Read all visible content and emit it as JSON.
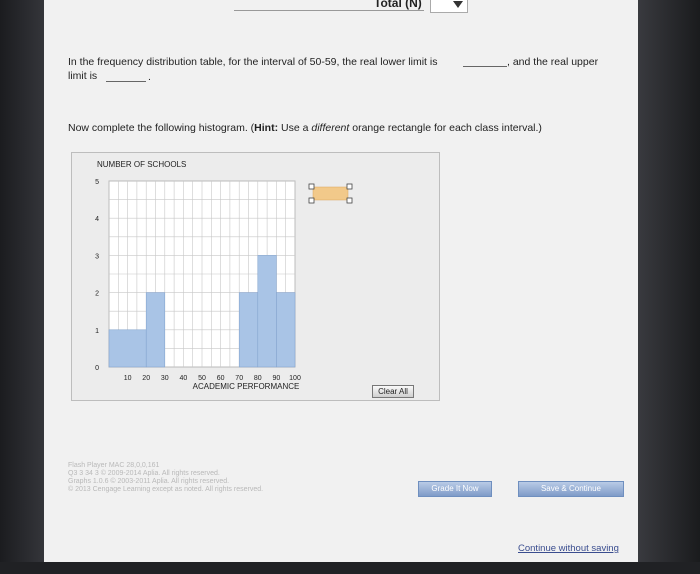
{
  "header": {
    "total_label": "Total (N)"
  },
  "question": {
    "part1": "In the frequency distribution table, for the interval of 50-59, the real lower limit is",
    "part2": ", and the real upper",
    "part3": "limit is",
    "part4": "."
  },
  "instruction": {
    "lead": "Now complete the following histogram. (",
    "hint_label": "Hint:",
    "hint_pre": " Use a ",
    "hint_em": "different",
    "hint_post": " orange rectangle for each class interval.)"
  },
  "chart_data": {
    "type": "bar",
    "ylabel": "NUMBER OF SCHOOLS",
    "xlabel": "ACADEMIC PERFORMANCE",
    "yticks": [
      0,
      1,
      2,
      3,
      4,
      5
    ],
    "xticks": [
      10,
      20,
      30,
      40,
      50,
      60,
      70,
      80,
      90,
      100
    ],
    "xlim": [
      0,
      100
    ],
    "ylim": [
      0,
      5
    ],
    "bars": [
      {
        "x0": 0,
        "x1": 20,
        "value": 1
      },
      {
        "x0": 20,
        "x1": 30,
        "value": 2
      },
      {
        "x0": 70,
        "x1": 80,
        "value": 2
      },
      {
        "x0": 80,
        "x1": 90,
        "value": 3
      },
      {
        "x0": 90,
        "x1": 100,
        "value": 2
      }
    ],
    "bar_color": "#a9c4e6",
    "template_color": "#f2c98a"
  },
  "chart_panel": {
    "clear_label": "Clear All"
  },
  "footer": {
    "lines": [
      "Flash Player MAC 28,0,0,161",
      "Q3 3 34 3 © 2009-2014 Aplia. All rights reserved.",
      "Graphs 1.0.6 © 2003-2011 Aplia. All rights reserved.",
      "© 2013 Cengage Learning except as noted. All rights reserved."
    ],
    "grade_label": "Grade It Now",
    "save_label": "Save & Continue",
    "continue_label": "Continue without saving"
  }
}
